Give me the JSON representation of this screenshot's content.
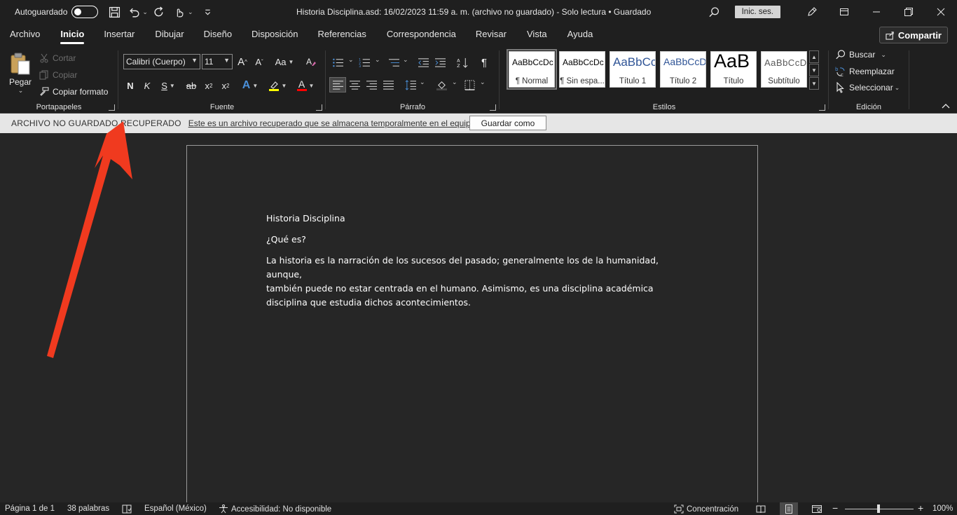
{
  "titlebar": {
    "autosave_label": "Autoguardado",
    "doc_title": "Historia Disciplina.asd: 16/02/2023 11:59 a. m. (archivo no guardado)  -  Solo lectura  •  Guardado",
    "signin_label": "Inic. ses."
  },
  "tabs": [
    {
      "label": "Archivo"
    },
    {
      "label": "Inicio"
    },
    {
      "label": "Insertar"
    },
    {
      "label": "Dibujar"
    },
    {
      "label": "Diseño"
    },
    {
      "label": "Disposición"
    },
    {
      "label": "Referencias"
    },
    {
      "label": "Correspondencia"
    },
    {
      "label": "Revisar"
    },
    {
      "label": "Vista"
    },
    {
      "label": "Ayuda"
    }
  ],
  "share_label": "Compartir",
  "clipboard": {
    "paste_label": "Pegar",
    "cut_label": "Cortar",
    "copy_label": "Copiar",
    "format_painter_label": "Copiar formato",
    "group_label": "Portapapeles"
  },
  "font": {
    "font_name": "Calibri (Cuerpo)",
    "font_size": "11",
    "change_case": "Aa",
    "grow": "A",
    "shrink": "A",
    "bold": "N",
    "italic": "K",
    "underline": "S",
    "strike": "ab",
    "subscript": "x",
    "superscript": "x",
    "effects": "A",
    "font_color": "A",
    "group_label": "Fuente"
  },
  "paragraph": {
    "pilcrow": "¶",
    "group_label": "Párrafo"
  },
  "styles": {
    "items": [
      {
        "sample": "AaBbCcDc",
        "name": "¶ Normal"
      },
      {
        "sample": "AaBbCcDc",
        "name": "¶ Sin espa..."
      },
      {
        "sample": "AaBbCc",
        "name": "Título 1"
      },
      {
        "sample": "AaBbCcD",
        "name": "Título 2"
      },
      {
        "sample": "AaB",
        "name": "Título"
      },
      {
        "sample": "AaBbCcD",
        "name": "Subtítulo"
      }
    ],
    "group_label": "Estilos"
  },
  "editing": {
    "find_label": "Buscar",
    "replace_label": "Reemplazar",
    "select_label": "Seleccionar",
    "group_label": "Edición"
  },
  "colors": {
    "highlight": "#ffff00",
    "font_color": "#ff0000",
    "effects": "#4a8fd8",
    "arrow": "#f03a1f"
  },
  "message_bar": {
    "title": "ARCHIVO NO GUARDADO RECUPERADO",
    "text": "Este es un archivo recuperado que se almacena temporalmente en el equipo.",
    "button_label": "Guardar como"
  },
  "document": {
    "title": "Historia Disciplina",
    "question": "¿Qué es?",
    "line1": "La historia es la narración de los sucesos del pasado; generalmente los de la humanidad, aunque,",
    "line2": "también puede no estar centrada en el humano. Asimismo, es una disciplina académica",
    "line3": "disciplina que estudia dichos acontecimientos."
  },
  "status": {
    "page": "Página 1 de 1",
    "words": "38 palabras",
    "language": "Español (México)",
    "accessibility": "Accesibilidad: No disponible",
    "focus": "Concentración",
    "zoom": "100%"
  }
}
